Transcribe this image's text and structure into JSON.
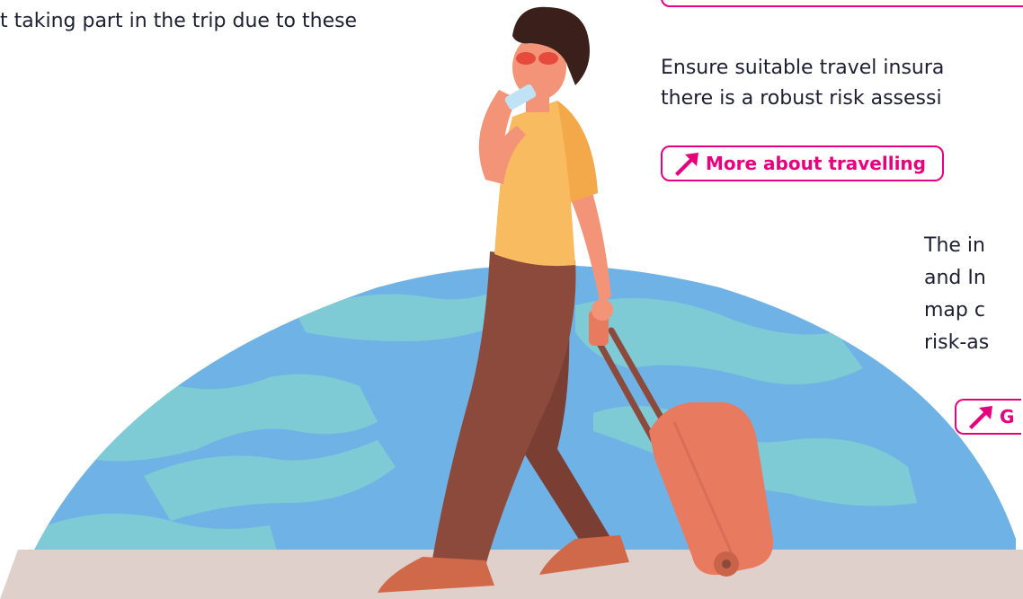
{
  "intro": {
    "partial_line": "t taking part in the trip due to these"
  },
  "travel": {
    "line1": "Ensure suitable travel insura",
    "line2": "there is a robust risk assessi",
    "link_label": "More about travelling"
  },
  "fragment": {
    "line1": "The in",
    "line2": "and In",
    "line3": "map c",
    "line4": "risk-as",
    "link_label": "G"
  },
  "icons": {
    "link_arrow": "arrow-up-right-icon"
  },
  "colors": {
    "accent": "#e6007e",
    "ocean": "#6fb3e6",
    "land": "#7ecbd6",
    "ground": "#dfd0cc",
    "shirt": "#f8bb5f",
    "trousers": "#8b4a3c",
    "suitcase": "#e87b5f",
    "skin": "#f39479",
    "hair": "#3a1f1a",
    "glasses": "#e64a3c"
  }
}
